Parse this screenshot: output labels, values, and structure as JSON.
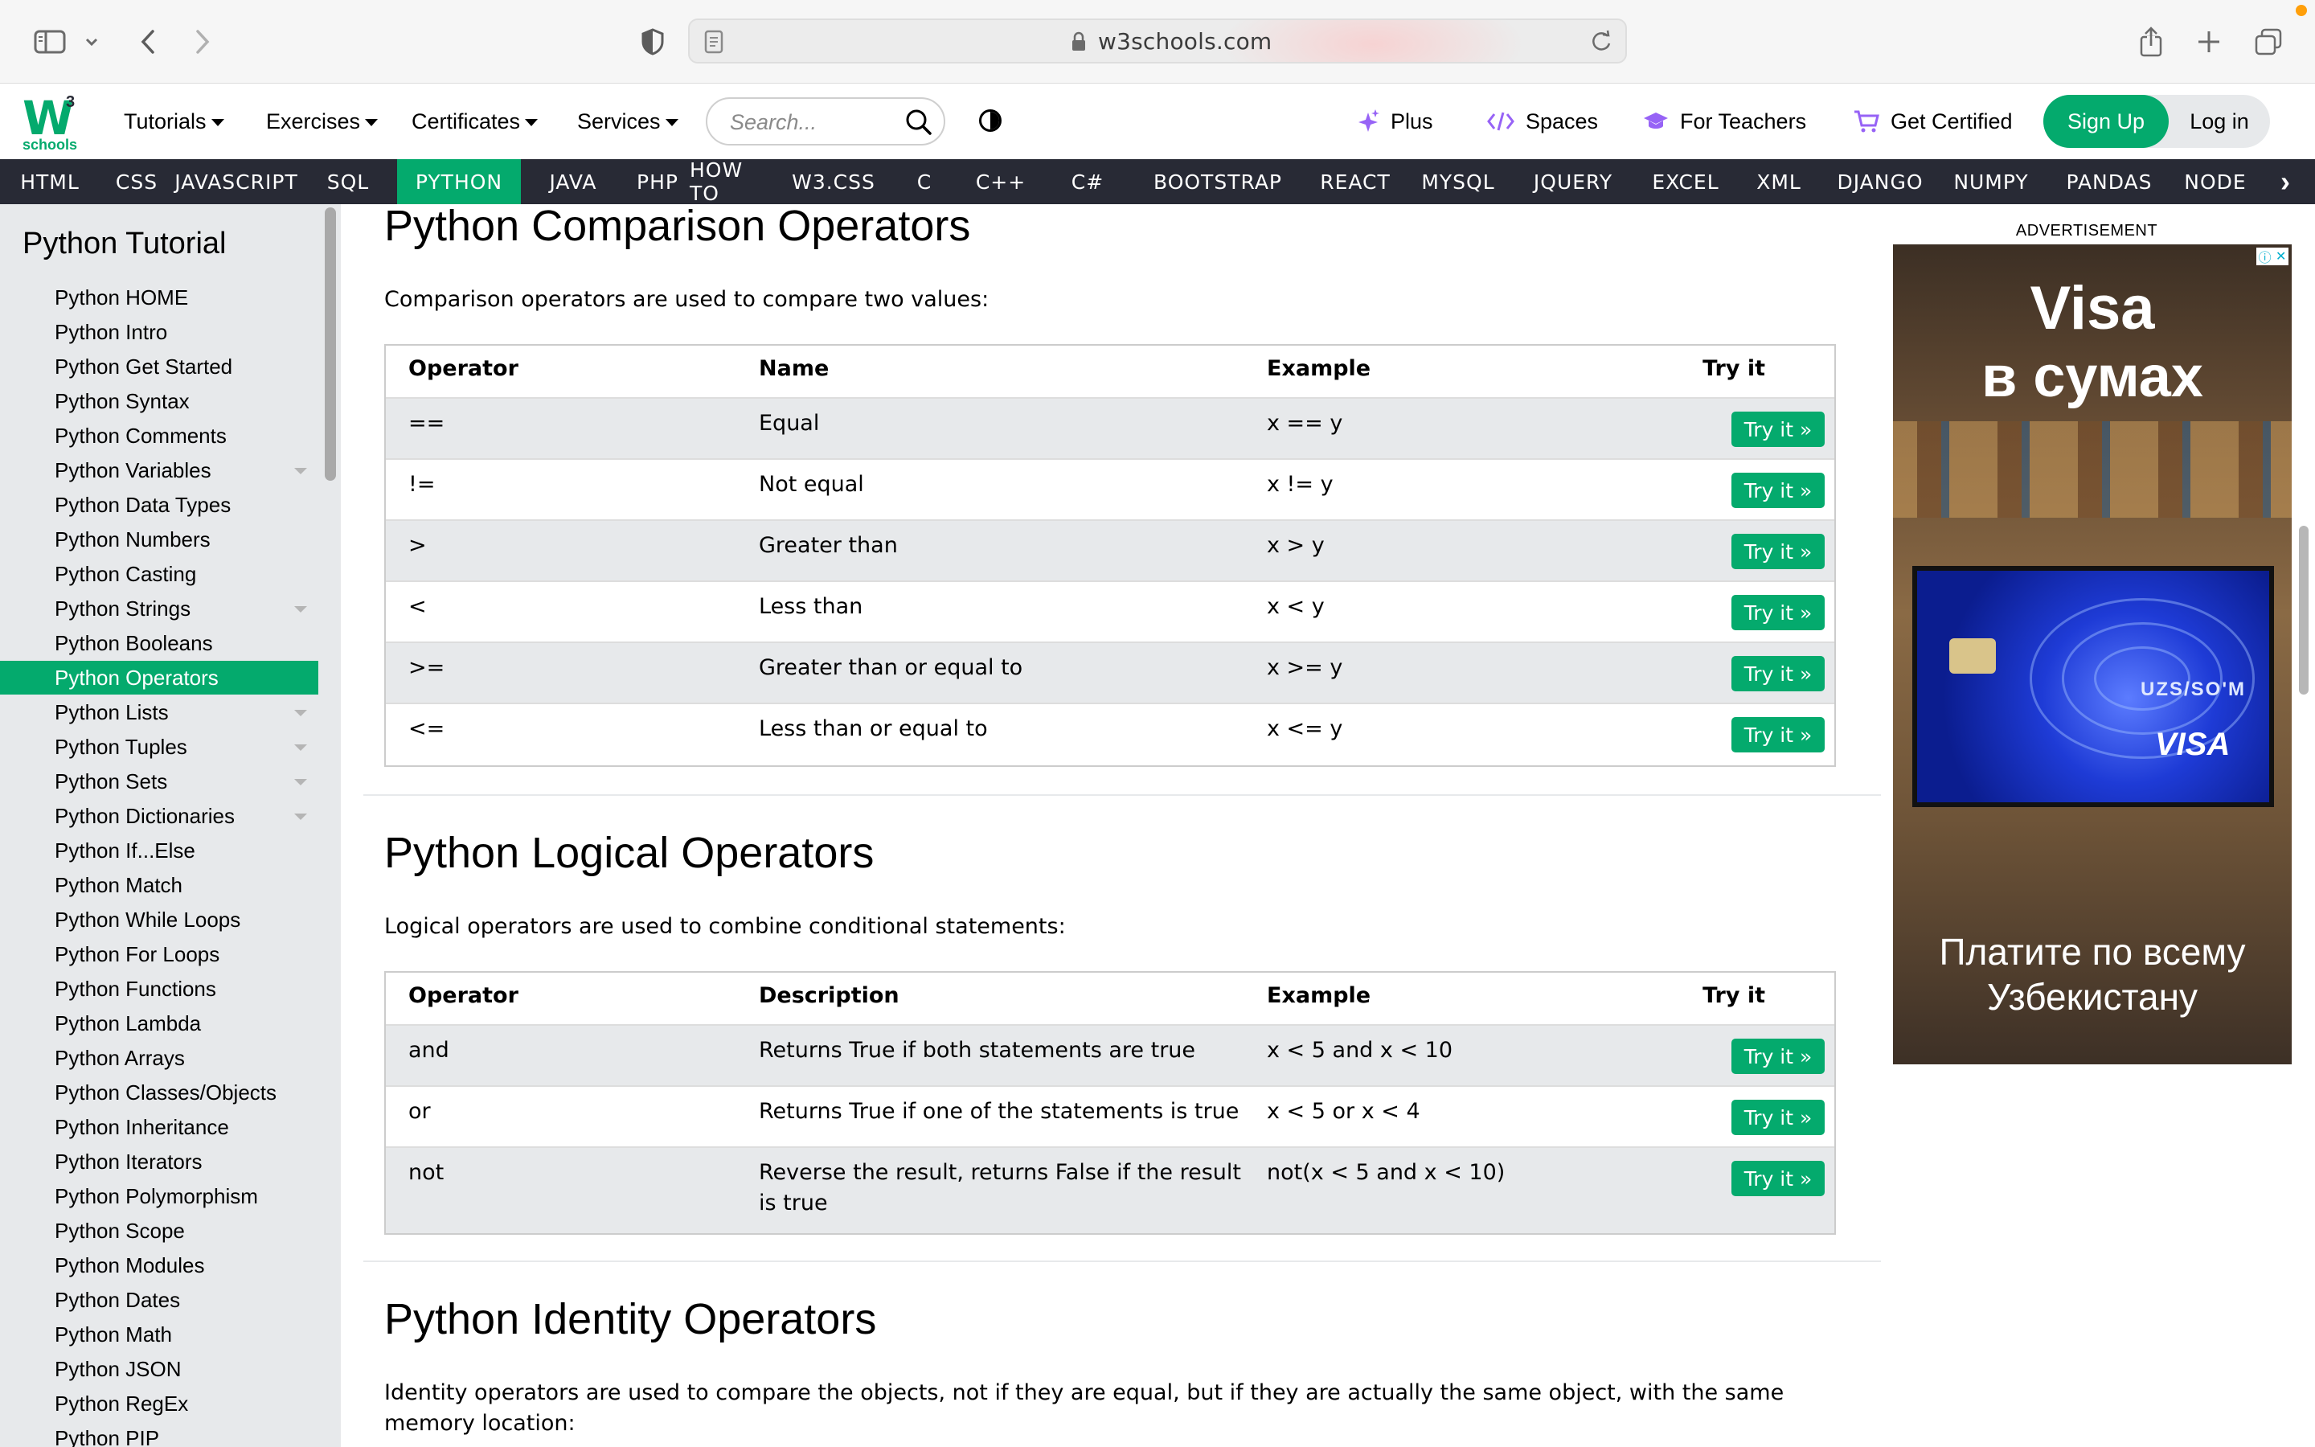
{
  "browser": {
    "url": "w3schools.com"
  },
  "topnav": {
    "logo_text": "W",
    "logo_sup": "3",
    "logo_sub": "schools",
    "menus": [
      "Tutorials",
      "Exercises",
      "Certificates",
      "Services"
    ],
    "search_placeholder": "Search...",
    "plus": "Plus",
    "spaces": "Spaces",
    "for_teachers": "For Teachers",
    "get_certified": "Get Certified",
    "sign_up": "Sign Up",
    "log_in": "Log in"
  },
  "langbar": {
    "items": [
      "HTML",
      "CSS",
      "JAVASCRIPT",
      "SQL",
      "PYTHON",
      "JAVA",
      "PHP",
      "HOW TO",
      "W3.CSS",
      "C",
      "C++",
      "C#",
      "BOOTSTRAP",
      "REACT",
      "MYSQL",
      "JQUERY",
      "EXCEL",
      "XML",
      "DJANGO",
      "NUMPY",
      "PANDAS",
      "NODE"
    ],
    "active": "PYTHON"
  },
  "sidebar": {
    "title": "Python Tutorial",
    "items": [
      "Python HOME",
      "Python Intro",
      "Python Get Started",
      "Python Syntax",
      "Python Comments",
      "Python Variables",
      "Python Data Types",
      "Python Numbers",
      "Python Casting",
      "Python Strings",
      "Python Booleans",
      "Python Operators",
      "Python Lists",
      "Python Tuples",
      "Python Sets",
      "Python Dictionaries",
      "Python If...Else",
      "Python Match",
      "Python While Loops",
      "Python For Loops",
      "Python Functions",
      "Python Lambda",
      "Python Arrays",
      "Python Classes/Objects",
      "Python Inheritance",
      "Python Iterators",
      "Python Polymorphism",
      "Python Scope",
      "Python Modules",
      "Python Dates",
      "Python Math",
      "Python JSON",
      "Python RegEx",
      "Python PIP"
    ],
    "active": "Python Operators"
  },
  "main": {
    "comparison": {
      "title": "Python Comparison Operators",
      "intro": "Comparison operators are used to compare two values:",
      "headers": [
        "Operator",
        "Name",
        "Example",
        "Try it"
      ],
      "rows": [
        [
          "==",
          "Equal",
          "x == y"
        ],
        [
          "!=",
          "Not equal",
          "x != y"
        ],
        [
          ">",
          "Greater than",
          "x > y"
        ],
        [
          "<",
          "Less than",
          "x < y"
        ],
        [
          ">=",
          "Greater than or equal to",
          "x >= y"
        ],
        [
          "<=",
          "Less than or equal to",
          "x <= y"
        ]
      ]
    },
    "logical": {
      "title": "Python Logical Operators",
      "intro": "Logical operators are used to combine conditional statements:",
      "headers": [
        "Operator",
        "Description",
        "Example",
        "Try it"
      ],
      "rows": [
        [
          "and",
          "Returns True if both statements are true",
          "x < 5 and  x < 10"
        ],
        [
          "or",
          "Returns True if one of the statements is true",
          "x < 5 or x < 4"
        ],
        [
          "not",
          "Reverse the result, returns False if the result is true",
          "not(x < 5 and x < 10)"
        ]
      ]
    },
    "identity": {
      "title": "Python Identity Operators",
      "intro": "Identity operators are used to compare the objects, not if they are equal, but if they are actually the same object, with the same memory location:"
    },
    "try_it_label": "Try it »"
  },
  "ad": {
    "label": "ADVERTISEMENT",
    "headline_1": "Visa",
    "headline_2": "в сумах",
    "card_currency": "UZS/SO'M",
    "card_brand": "VISA",
    "footer": "Платите по всему Узбекистану"
  },
  "colors": {
    "brand_green": "#04aa6d",
    "nav_dark": "#282a35",
    "sidebar_bg": "#e7e9eb"
  }
}
